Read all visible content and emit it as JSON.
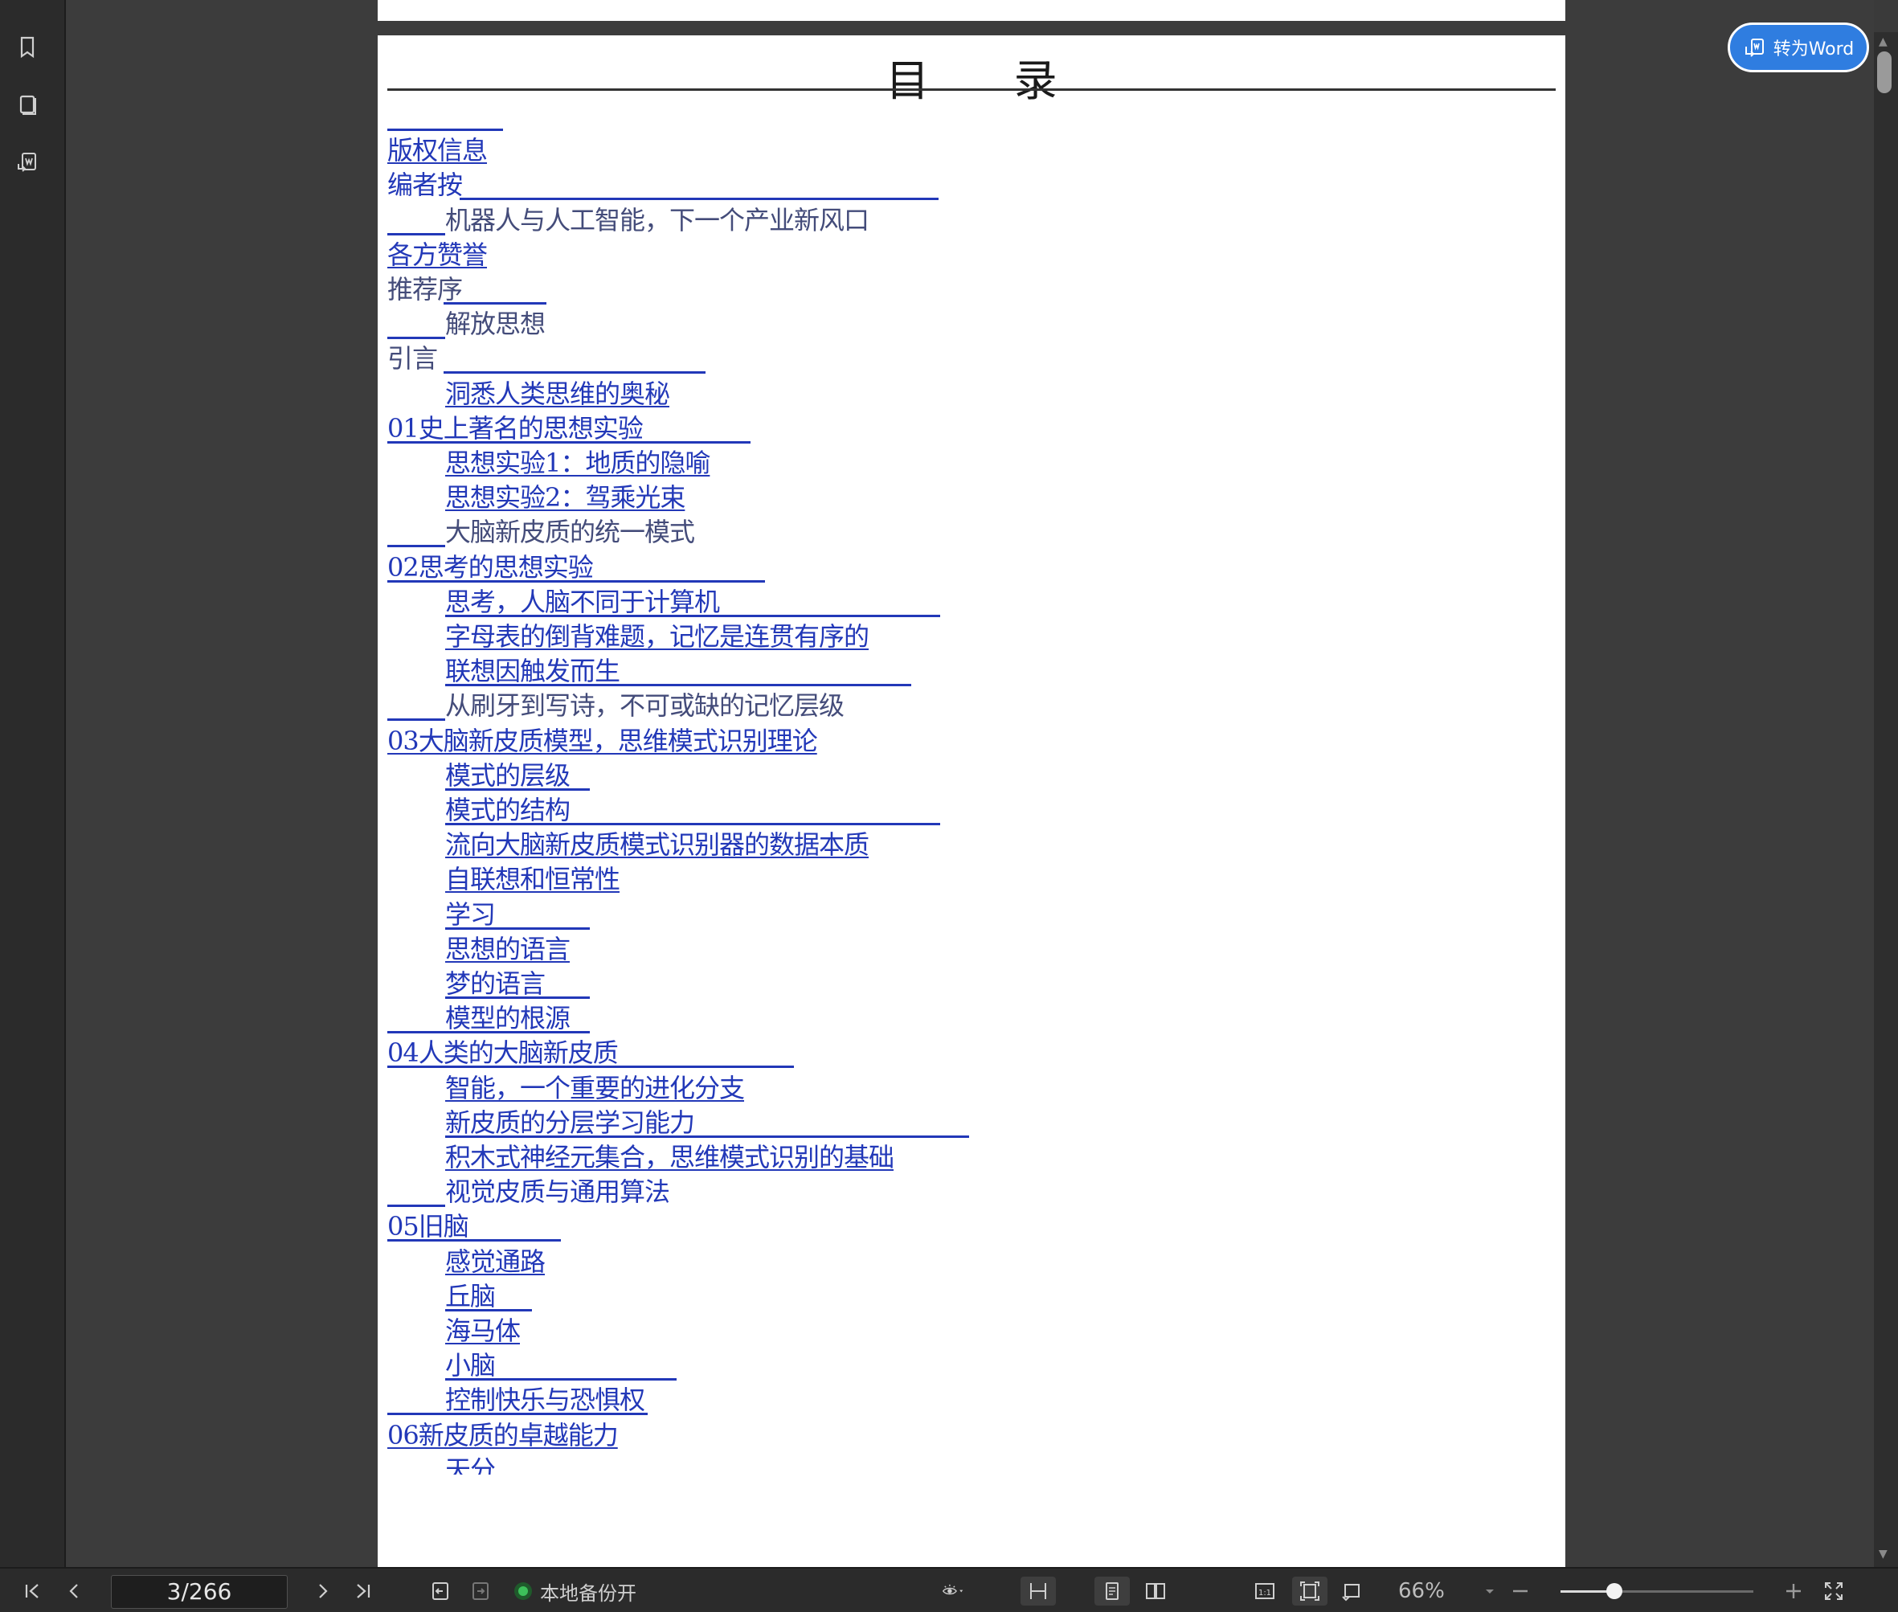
{
  "convert_button": {
    "label": "转为Word"
  },
  "toc": {
    "title": "目  录",
    "entries": [
      {
        "text": "",
        "indent": 0,
        "underline_w": 144
      },
      {
        "text": "版权信息",
        "indent": 0,
        "underline_w": 0,
        "text_ul": true
      },
      {
        "text": "编者按",
        "indent": 0,
        "underline_w": 596,
        "ul_start": 90
      },
      {
        "text": "机器人与人工智能，下一个产业新风口",
        "indent": 1,
        "underline_w": 72,
        "ul_start": -72,
        "dark": true
      },
      {
        "text": "各方赞誉",
        "indent": 0,
        "underline_w": 0,
        "text_ul": true
      },
      {
        "text": "推荐序",
        "indent": 0,
        "underline_w": 128,
        "ul_start": 70,
        "dark": true
      },
      {
        "text": "解放思想",
        "indent": 1,
        "underline_w": 72,
        "ul_start": -72,
        "dark": true
      },
      {
        "text": "引言",
        "indent": 0,
        "underline_w": 326,
        "ul_start": 70,
        "dark": true
      },
      {
        "text": "洞悉人类思维的奥秘",
        "indent": 1,
        "underline_w": 0,
        "text_ul": true
      },
      {
        "text": "01史上著名的思想实验",
        "indent": 0,
        "underline_w": 452,
        "ul_start": 0
      },
      {
        "text": "思想实验1：地质的隐喻",
        "indent": 1,
        "underline_w": 0,
        "text_ul": true
      },
      {
        "text": "思想实验2：驾乘光束",
        "indent": 1,
        "underline_w": 0,
        "text_ul": true
      },
      {
        "text": "大脑新皮质的统一模式",
        "indent": 1,
        "underline_w": 72,
        "ul_start": -72,
        "dark": true
      },
      {
        "text": "02思考的思想实验",
        "indent": 0,
        "underline_w": 470,
        "ul_start": 0
      },
      {
        "text": "思考，人脑不同于计算机",
        "indent": 1,
        "underline_w": 616,
        "ul_start": 0
      },
      {
        "text": "字母表的倒背难题，记忆是连贯有序的",
        "indent": 1,
        "underline_w": 0,
        "text_ul": true
      },
      {
        "text": "联想因触发而生",
        "indent": 1,
        "underline_w": 580,
        "ul_start": 0
      },
      {
        "text": "从刷牙到写诗，不可或缺的记忆层级",
        "indent": 1,
        "underline_w": 72,
        "ul_start": -72,
        "dark": true
      },
      {
        "text": "03大脑新皮质模型，思维模式识别理论",
        "indent": 0,
        "underline_w": 0,
        "text_ul": true
      },
      {
        "text": "模式的层级",
        "indent": 1,
        "underline_w": 180,
        "ul_start": 0
      },
      {
        "text": "模式的结构",
        "indent": 1,
        "underline_w": 616,
        "ul_start": 0
      },
      {
        "text": "流向大脑新皮质模式识别器的数据本质",
        "indent": 1,
        "underline_w": 0,
        "text_ul": true
      },
      {
        "text": "自联想和恒常性",
        "indent": 1,
        "underline_w": 0,
        "text_ul": true
      },
      {
        "text": "学习",
        "indent": 1,
        "underline_w": 180,
        "ul_start": 0
      },
      {
        "text": "思想的语言",
        "indent": 1,
        "underline_w": 0,
        "text_ul": true
      },
      {
        "text": "梦的语言",
        "indent": 1,
        "underline_w": 180,
        "ul_start": 0
      },
      {
        "text": "模型的根源",
        "indent": 1,
        "underline_w": 252,
        "ul_start": -72
      },
      {
        "text": "04人类的大脑新皮质",
        "indent": 0,
        "underline_w": 506,
        "ul_start": 0
      },
      {
        "text": "智能，一个重要的进化分支",
        "indent": 1,
        "underline_w": 0,
        "text_ul": true
      },
      {
        "text": "新皮质的分层学习能力",
        "indent": 1,
        "underline_w": 652,
        "ul_start": 0
      },
      {
        "text": "积木式神经元集合，思维模式识别的基础",
        "indent": 1,
        "underline_w": 0,
        "text_ul": true
      },
      {
        "text": "视觉皮质与通用算法",
        "indent": 1,
        "underline_w": 72,
        "ul_start": -72
      },
      {
        "text": "05旧脑",
        "indent": 0,
        "underline_w": 216,
        "ul_start": 0
      },
      {
        "text": "感觉通路",
        "indent": 1,
        "underline_w": 0,
        "text_ul": true
      },
      {
        "text": "丘脑",
        "indent": 1,
        "underline_w": 108,
        "ul_start": 0
      },
      {
        "text": "海马体",
        "indent": 1,
        "underline_w": 0,
        "text_ul": true
      },
      {
        "text": "小脑",
        "indent": 1,
        "underline_w": 288,
        "ul_start": 0
      },
      {
        "text": "控制快乐与恐惧权",
        "indent": 1,
        "underline_w": 324,
        "ul_start": -72
      },
      {
        "text": "06新皮质的卓越能力",
        "indent": 0,
        "underline_w": 0,
        "text_ul": true
      },
      {
        "text": "天分",
        "indent": 1,
        "underline_w": 0,
        "clip": true
      }
    ]
  },
  "toolbar": {
    "page_indicator": "3/266",
    "backup_label": "本地备份开",
    "zoom_label": "66%",
    "zoom_fraction": 0.28
  },
  "icons": {
    "sidebar": [
      "bookmark-icon",
      "thumbnails-icon",
      "convert-doc-icon"
    ],
    "bottom": [
      "first-page-icon",
      "prev-page-icon",
      "next-page-icon",
      "last-page-icon",
      "back-icon",
      "forward-icon",
      "eye-protection-icon",
      "fit-width-icon",
      "single-page-icon",
      "two-page-icon",
      "actual-size-icon",
      "fit-page-icon",
      "rotate-icon",
      "zoom-out-icon",
      "zoom-in-icon",
      "fullscreen-icon"
    ]
  }
}
